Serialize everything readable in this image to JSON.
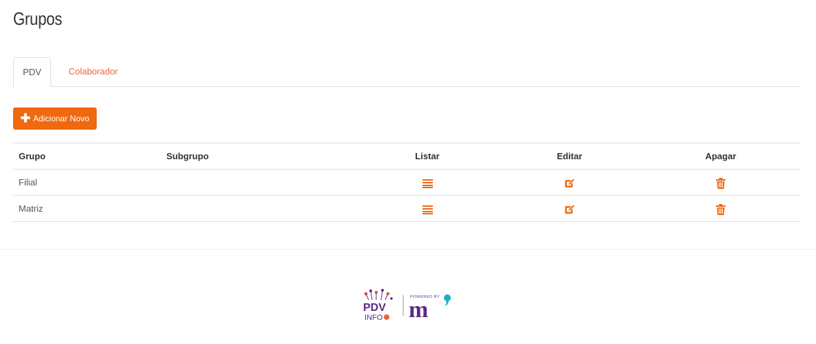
{
  "page": {
    "title": "Grupos"
  },
  "tabs": [
    {
      "label": "PDV",
      "active": true
    },
    {
      "label": "Colaborador",
      "active": false
    }
  ],
  "toolbar": {
    "add_label": "Adicionar Novo",
    "add_icon": "plus-icon"
  },
  "table": {
    "headers": {
      "grupo": "Grupo",
      "subgrupo": "Subgrupo",
      "listar": "Listar",
      "editar": "Editar",
      "apagar": "Apagar"
    },
    "rows": [
      {
        "grupo": "Filial",
        "subgrupo": ""
      },
      {
        "grupo": "Matriz",
        "subgrupo": ""
      }
    ],
    "icons": {
      "listar": "list-icon",
      "editar": "edit-icon",
      "apagar": "trash-icon"
    }
  },
  "footer": {
    "logo_text": "PDV",
    "logo_subtext": "INFO",
    "powered_by": "POWERED BY",
    "brand_mark": "m"
  },
  "colors": {
    "accent": "#f0690f",
    "tab_link": "#e8663d",
    "logo_purple": "#5b2a86",
    "logo_teal": "#1ab0c8"
  }
}
